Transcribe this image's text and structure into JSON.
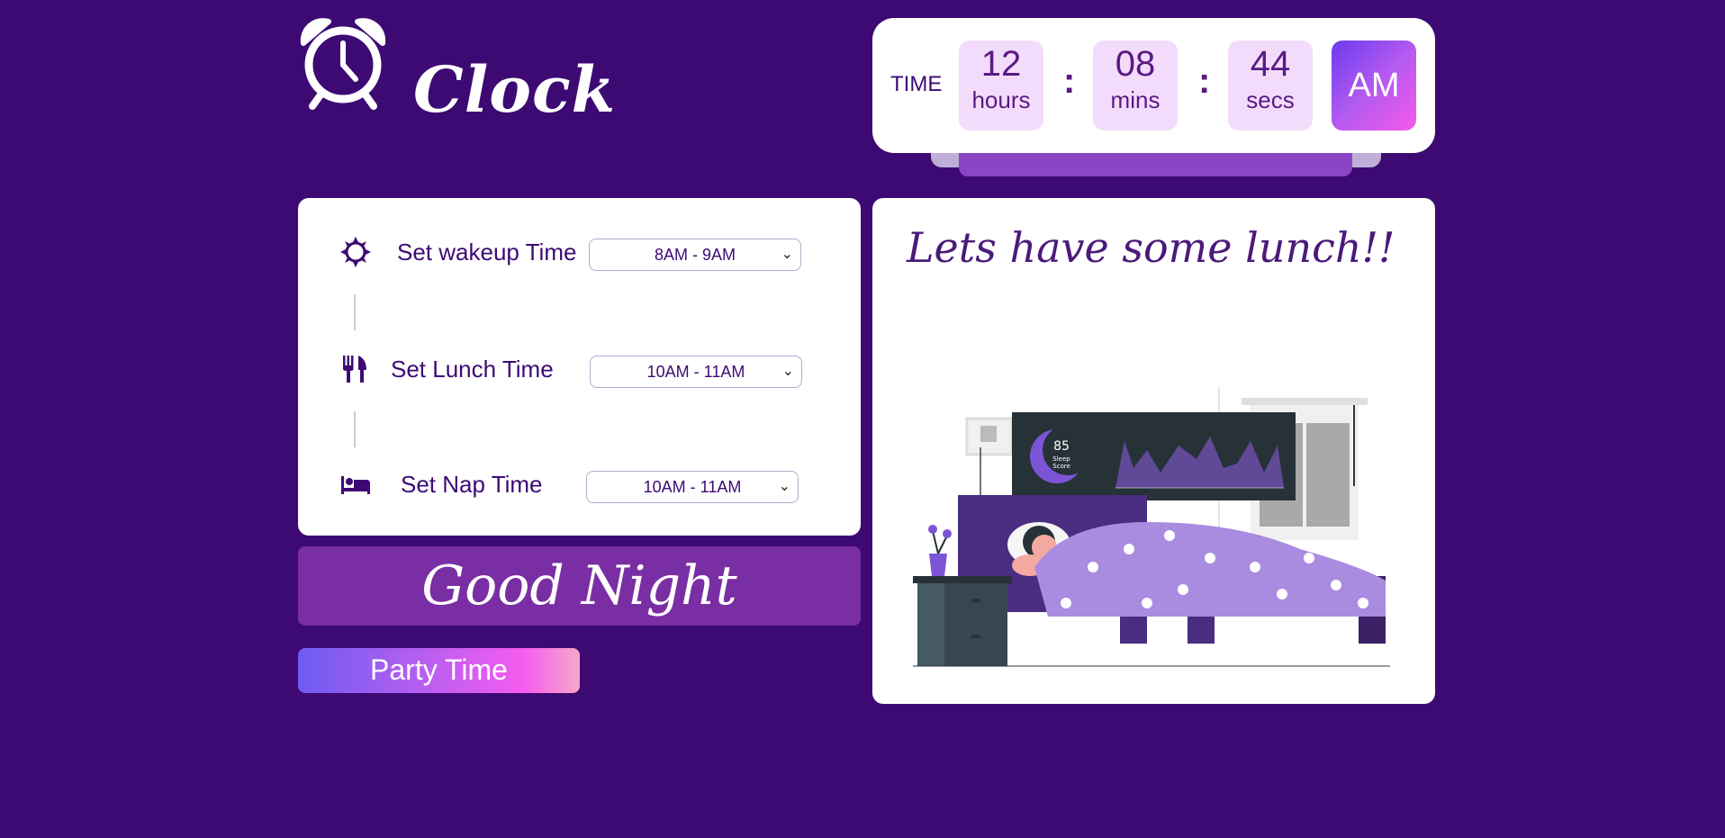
{
  "app": {
    "title": "Clock"
  },
  "clock": {
    "label": "TIME",
    "hours": "12",
    "hours_label": "hours",
    "minutes": "08",
    "minutes_label": "mins",
    "seconds": "44",
    "seconds_label": "secs",
    "separator": ":",
    "ampm": "AM"
  },
  "settings": {
    "wakeup": {
      "label": "Set wakeup Time",
      "value": "8AM - 9AM",
      "icon": "sun-icon"
    },
    "lunch": {
      "label": "Set Lunch Time",
      "value": "10AM - 11AM",
      "icon": "fork-knife-icon"
    },
    "nap": {
      "label": "Set Nap Time",
      "value": "10AM - 11AM",
      "icon": "bed-icon"
    }
  },
  "good_night": "Good Night",
  "party_button": "Party Time",
  "message": {
    "text": "Lets have some lunch!!"
  },
  "illustration": {
    "sleep_score": "85",
    "sleep_label_1": "Sleep",
    "sleep_label_2": "Score"
  },
  "colors": {
    "background": "#3d0a74",
    "accent": "#7a2ea3",
    "card": "#ffffff"
  }
}
